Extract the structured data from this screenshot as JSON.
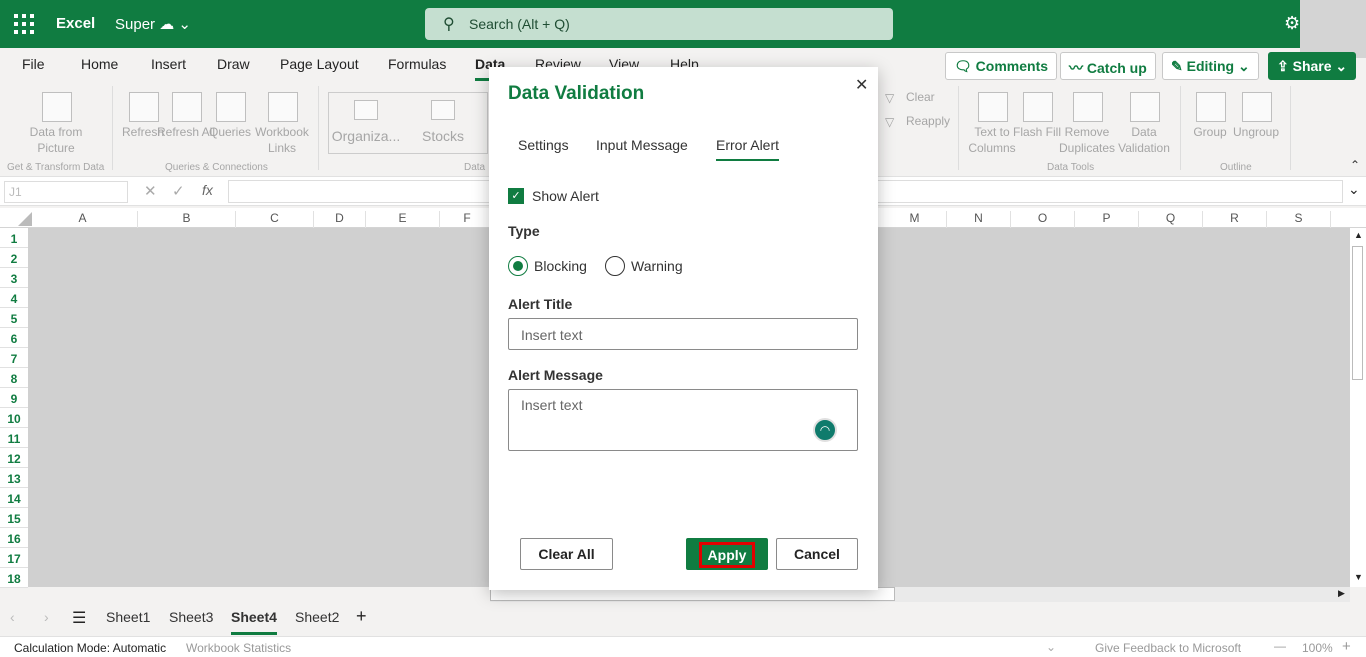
{
  "app": {
    "name": "Excel",
    "document": "Super",
    "search_placeholder": "Search (Alt + Q)"
  },
  "menu_tabs": [
    "File",
    "Home",
    "Insert",
    "Draw",
    "Page Layout",
    "Formulas",
    "Data",
    "Review",
    "View",
    "Help"
  ],
  "active_tab": "Data",
  "right_buttons": {
    "comments": "Comments",
    "catch_up": "Catch up",
    "editing": "Editing",
    "share": "Share"
  },
  "ribbon": {
    "items": [
      "Data from Picture",
      "Refresh",
      "Refresh All",
      "Queries",
      "Workbook Links",
      "Organiza...",
      "Stocks",
      "Clear",
      "Reapply",
      "Text to Columns",
      "Flash Fill",
      "Remove Duplicates",
      "Data Validation",
      "Group",
      "Ungroup"
    ],
    "groups": [
      "Get & Transform Data",
      "Queries & Connections",
      "Data",
      "Data Tools",
      "Outline"
    ]
  },
  "formula_bar": {
    "name_box": "J1",
    "fx": "fx"
  },
  "columns": [
    "A",
    "B",
    "C",
    "D",
    "E",
    "F",
    "M",
    "N",
    "O",
    "P",
    "Q",
    "R",
    "S"
  ],
  "rows": [
    "1",
    "2",
    "3",
    "4",
    "5",
    "6",
    "7",
    "8",
    "9",
    "10",
    "11",
    "12",
    "13",
    "14",
    "15",
    "16",
    "17",
    "18"
  ],
  "sheets": [
    "Sheet1",
    "Sheet3",
    "Sheet4",
    "Sheet2"
  ],
  "active_sheet": "Sheet4",
  "status": {
    "calc_mode": "Calculation Mode: Automatic",
    "stats": "Workbook Statistics",
    "feedback": "Give Feedback to Microsoft",
    "zoom": "100%"
  },
  "dialog": {
    "title": "Data Validation",
    "tabs": [
      "Settings",
      "Input Message",
      "Error Alert"
    ],
    "active_tab": "Error Alert",
    "show_alert_label": "Show Alert",
    "show_alert_checked": true,
    "type_label": "Type",
    "type_options": [
      "Blocking",
      "Warning"
    ],
    "type_selected": "Blocking",
    "alert_title_label": "Alert Title",
    "alert_title_placeholder": "Insert text",
    "alert_message_label": "Alert Message",
    "alert_message_placeholder": "Insert text",
    "clear_all": "Clear All",
    "apply": "Apply",
    "cancel": "Cancel"
  },
  "colors": {
    "brand": "#107c41",
    "highlight": "#e00000"
  }
}
